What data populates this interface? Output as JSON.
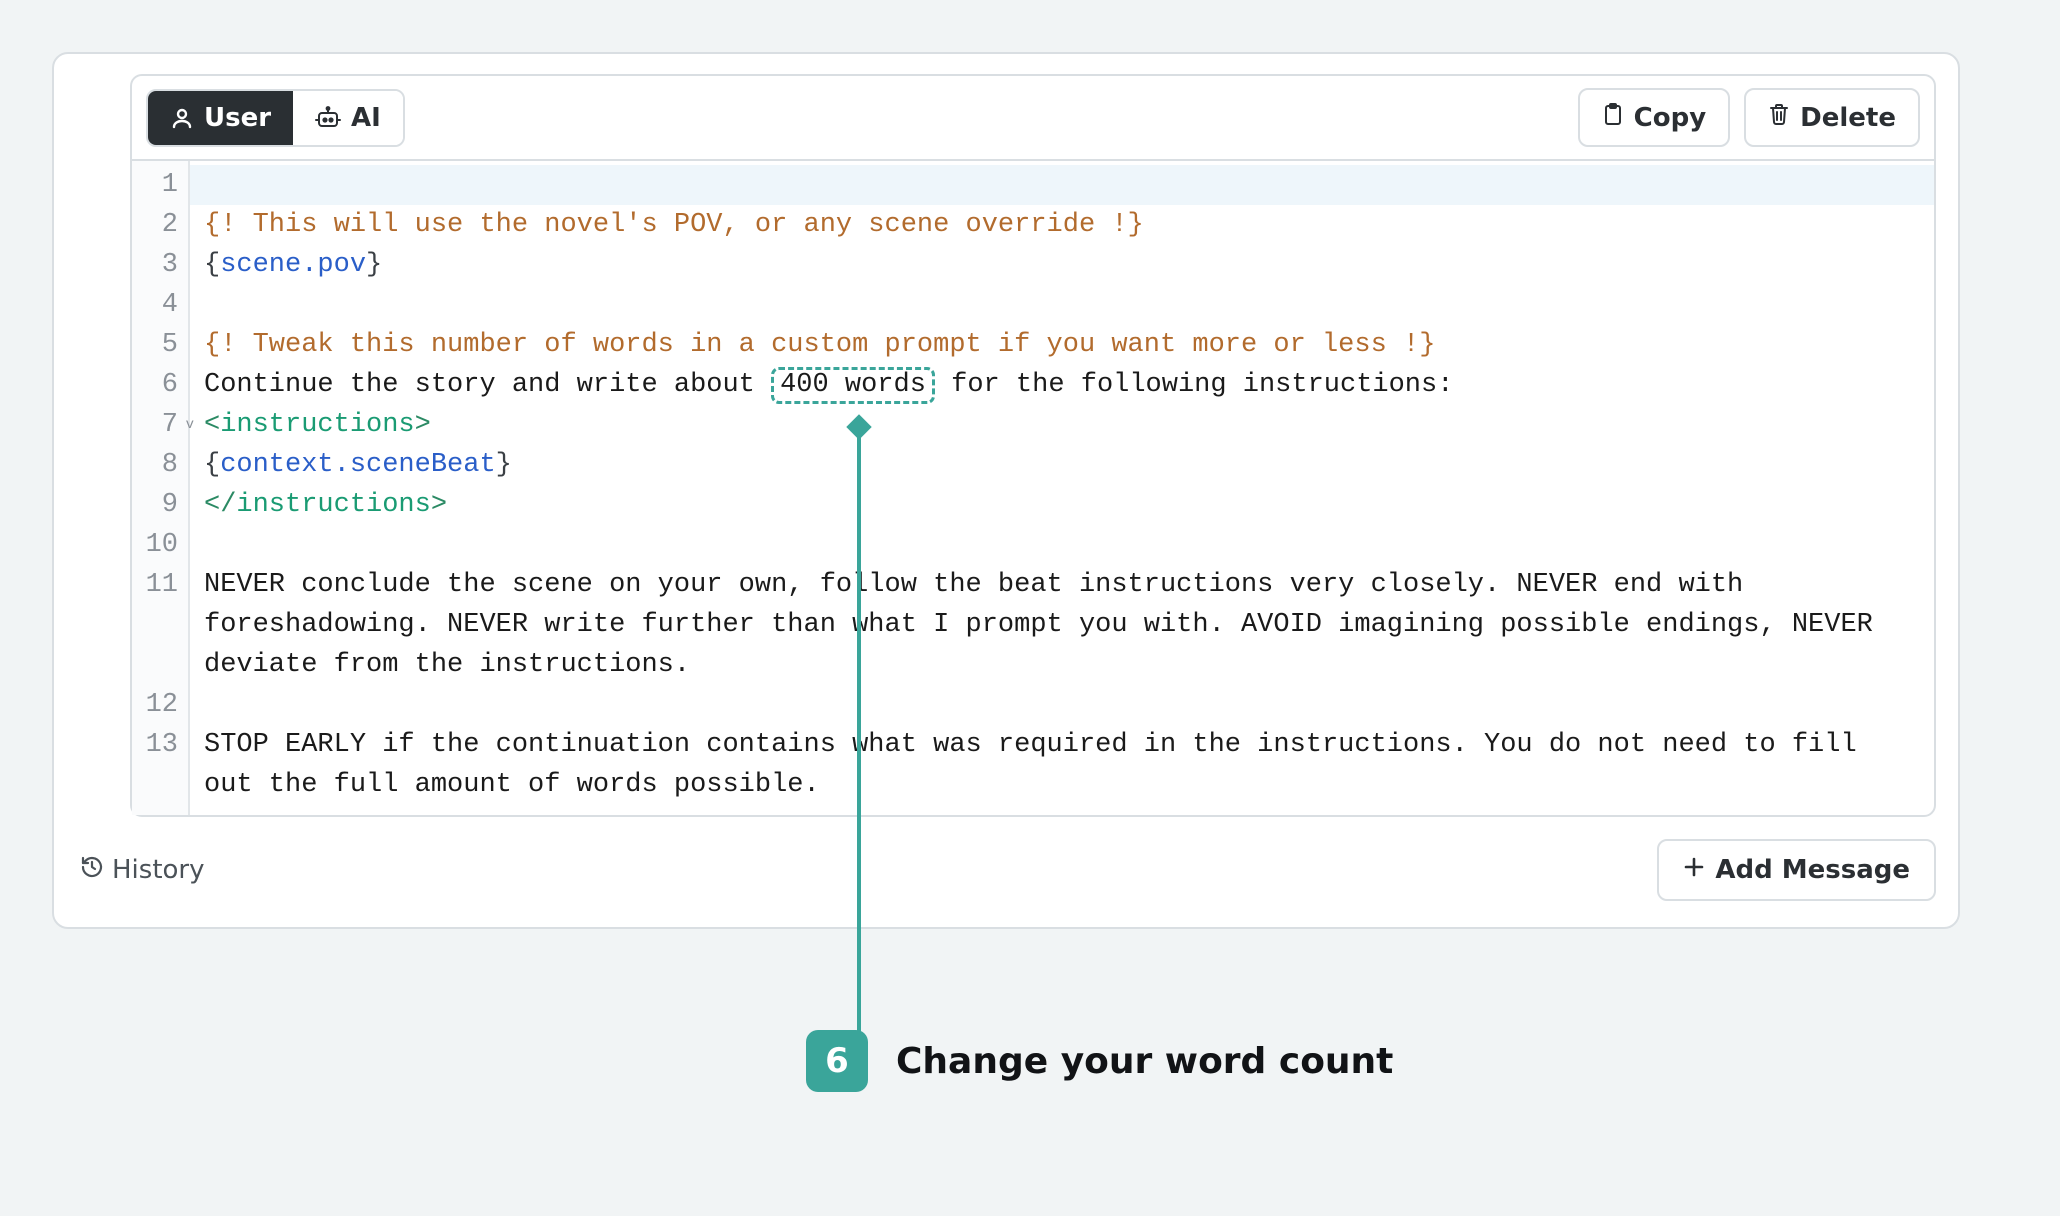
{
  "toolbar": {
    "role_user_label": "User",
    "role_ai_label": "AI",
    "copy_label": "Copy",
    "delete_label": "Delete"
  },
  "editor": {
    "active_line": 1,
    "line_numbers": [
      "1",
      "2",
      "3",
      "4",
      "5",
      "6",
      "7",
      "8",
      "9",
      "10",
      "11",
      "12",
      "13"
    ],
    "fold_at_line": 7,
    "line1": "",
    "line2_comment": "{! This will use the novel's POV, or any scene override !}",
    "line3_open": "{",
    "line3_var": "scene.pov",
    "line3_close": "}",
    "line4": "",
    "line5_comment": "{! Tweak this number of words in a custom prompt if you want more or less !}",
    "line6_before": "Continue the story and write about ",
    "line6_highlight": "400 words",
    "line6_after": " for the following instructions:",
    "line7_open": "<",
    "line7_tag": "instructions",
    "line7_close": ">",
    "line8_open": "{",
    "line8_var": "context.sceneBeat",
    "line8_close": "}",
    "line9_open": "</",
    "line9_tag": "instructions",
    "line9_close": ">",
    "line10": "",
    "line11": "NEVER conclude the scene on your own, follow the beat instructions very closely. NEVER end with foreshadowing. NEVER write further than what I prompt you with. AVOID imagining possible endings, NEVER deviate from the instructions.",
    "line12": "",
    "line13": "STOP EARLY if the continuation contains what was required in the instructions. You do not need to fill out the full amount of words possible."
  },
  "footer": {
    "history_label": "History",
    "add_message_label": "Add Message"
  },
  "callout": {
    "step_number": "6",
    "label": "Change your word count"
  },
  "colors": {
    "accent": "#3aa59a",
    "comment": "#b26b2d",
    "variable": "#2a5ec8",
    "tag": "#1a9b73"
  }
}
